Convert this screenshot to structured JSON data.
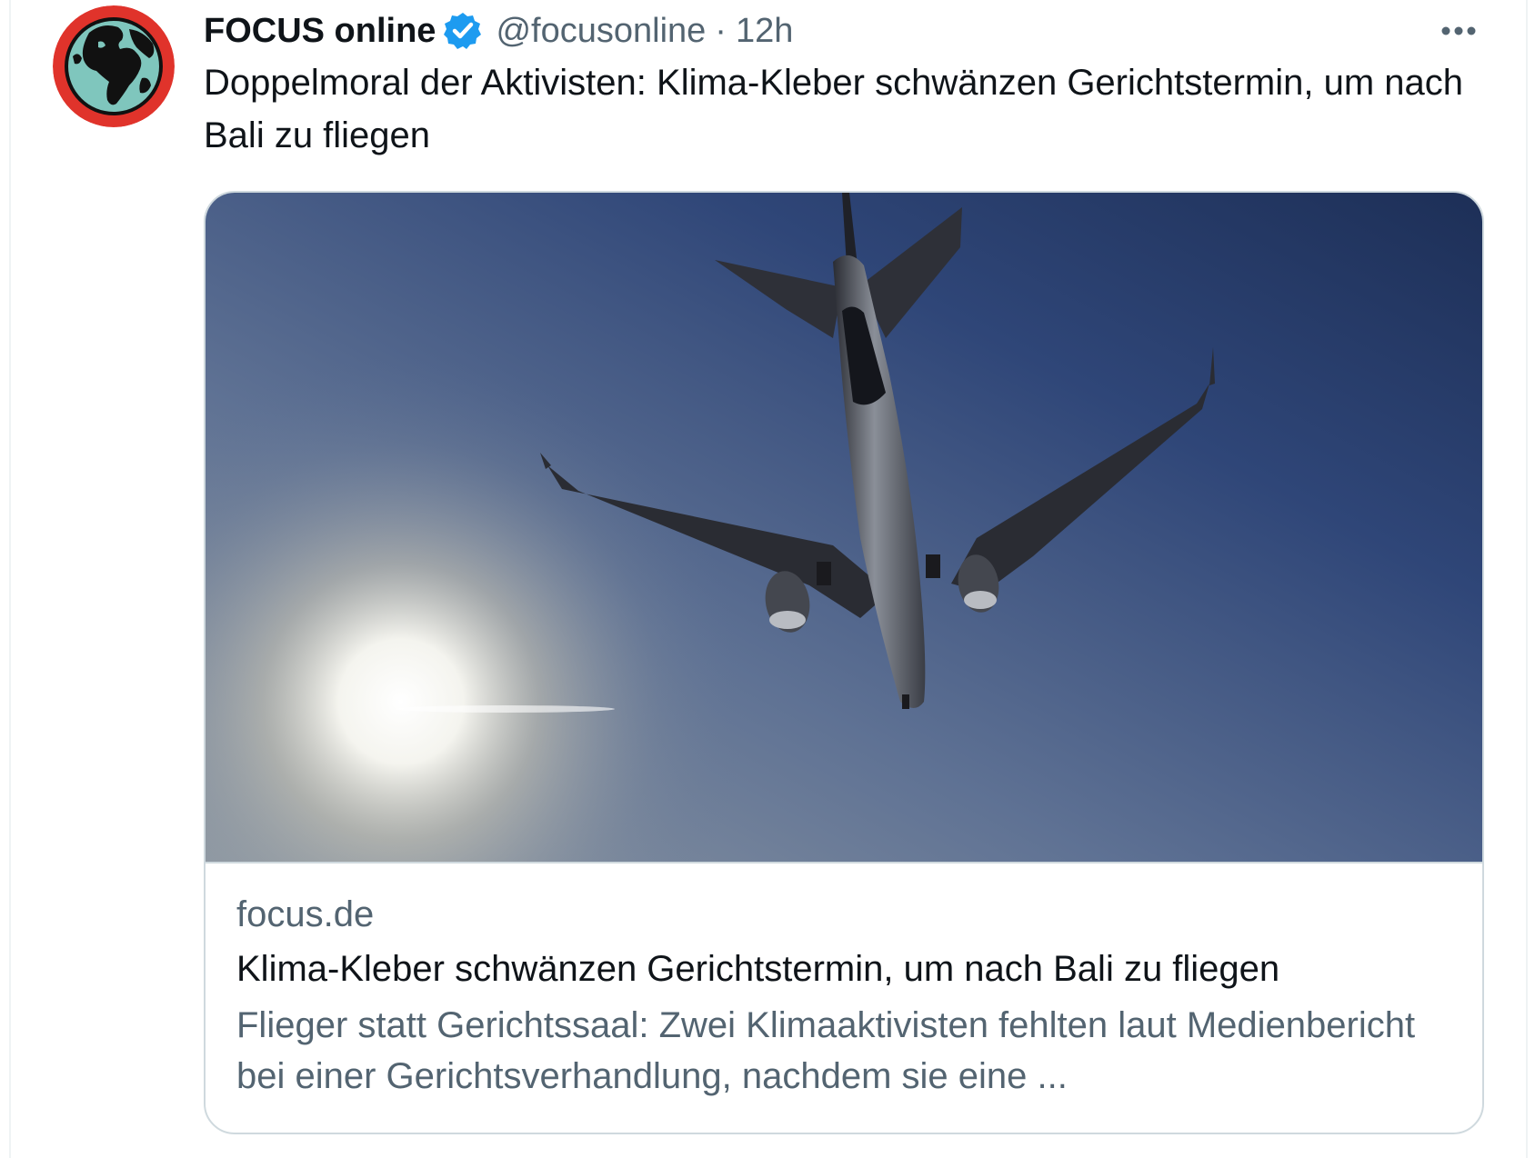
{
  "tweet": {
    "author": {
      "display_name": "FOCUS online",
      "handle": "@focusonline",
      "verified": true,
      "avatar_icon": "globe-logo-icon"
    },
    "separator": "·",
    "timestamp": "12h",
    "more_icon": "more-options-icon",
    "text": "Doppelmoral der Aktivisten: Klima-Kleber schwänzen Gerichtstermin, um nach Bali zu fliegen",
    "card": {
      "image_icon": "airplane-photo",
      "domain": "focus.de",
      "title": "Klima-Kleber schwänzen Gerichtstermin, um nach Bali zu fliegen",
      "description": "Flieger statt Gerichtssaal: Zwei Klimaaktivisten fehlten laut Medienbericht bei einer Gerichtsverhandlung, nachdem sie eine ..."
    }
  },
  "colors": {
    "text_primary": "#0f1419",
    "text_secondary": "#536471",
    "verified_blue": "#1d9bf0",
    "card_border": "#cfd9de",
    "avatar_ring": "#e0332b",
    "avatar_land": "#111111",
    "avatar_ocean": "#7fc6bd",
    "sky_dark": "#1d2f57",
    "sun_glow": "#ffffff"
  }
}
